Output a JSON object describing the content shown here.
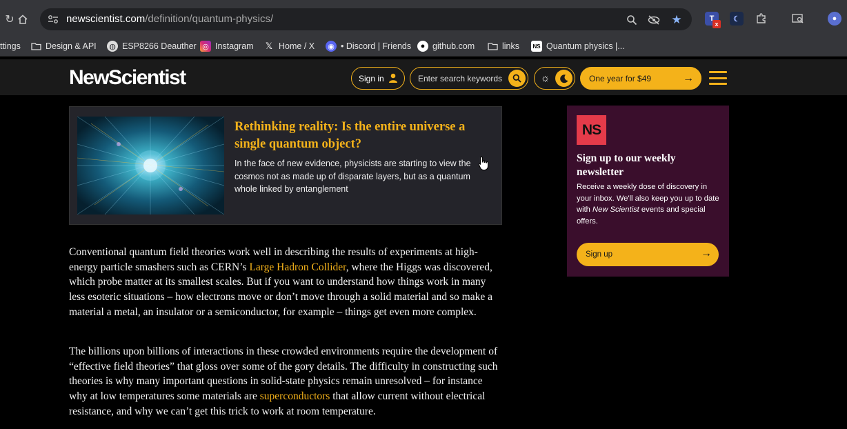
{
  "browser": {
    "url_host": "newscientist.com",
    "url_path": "/definition/quantum-physics/",
    "bookmarks": [
      {
        "label": "ttings",
        "icon": "gear-icon"
      },
      {
        "label": "Design & API",
        "icon": "folder-icon"
      },
      {
        "label": "ESP8266 Deauther",
        "icon": "globe-icon"
      },
      {
        "label": "Instagram",
        "icon": "instagram-icon"
      },
      {
        "label": "Home / X",
        "icon": "x-icon"
      },
      {
        "label": "• Discord | Friends",
        "icon": "discord-icon"
      },
      {
        "label": "github.com",
        "icon": "github-icon"
      },
      {
        "label": "links",
        "icon": "folder-icon"
      },
      {
        "label": "Quantum physics |...",
        "icon": "ns-icon"
      }
    ]
  },
  "header": {
    "logo": "NewScientist",
    "signin_label": "Sign in",
    "search_placeholder": "Enter search keywords",
    "offer_label": "One year for $49",
    "accent": "#f4b21a"
  },
  "card": {
    "title": "Rethinking reality: Is the entire universe a single quantum object?",
    "description": "In the face of new evidence, physicists are starting to view the cosmos not as made up of disparate layers, but as a quantum whole linked by entanglement"
  },
  "article": {
    "p1_before": "Conventional quantum field theories work well in describing the results of experiments at high-energy particle smashers such as CERN’s ",
    "p1_link": "Large Hadron Collider",
    "p1_after": ", where the Higgs was discovered, which probe matter at its smallest scales. But if you want to understand how things work in many less esoteric situations – how electrons move or don’t move through a solid material and so make a material a metal, an insulator or a semiconductor, for example – things get even more complex.",
    "p2_before": "The billions upon billions of interactions in these crowded environments require the development of “effective field theories” that gloss over some of the gory details. The difficulty in constructing such theories is why many important questions in solid-state physics remain unresolved – for instance why at low temperatures some materials are ",
    "p2_link": "superconductors",
    "p2_after": " that allow current without electrical resistance, and why we can’t get this trick to work at room temperature."
  },
  "newsletter": {
    "badge": "NS",
    "title": "Sign up to our weekly newsletter",
    "desc_1": "Receive a weekly dose of discovery in your inbox. We'll also keep you up to date with ",
    "desc_em": "New Scientist",
    "desc_2": " events and special offers.",
    "button_label": "Sign up",
    "bg_color": "#3a0e2c"
  }
}
